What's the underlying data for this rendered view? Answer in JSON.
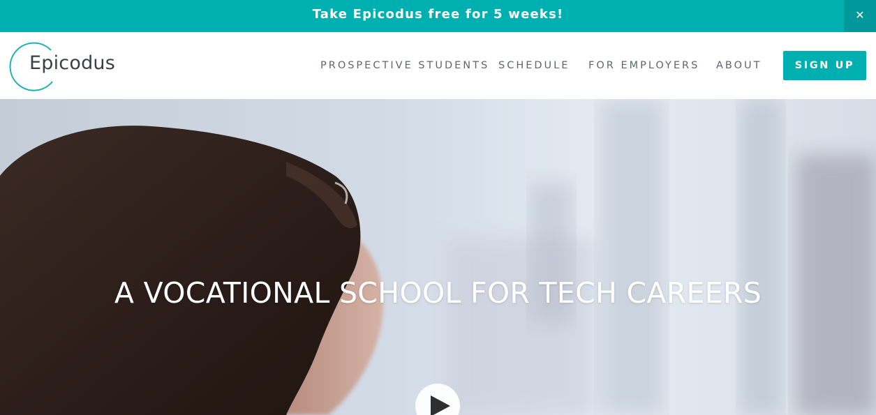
{
  "banner": {
    "text": "Take Epicodus free for 5 weeks!",
    "close_label": "✕"
  },
  "header": {
    "logo_text": "Epicodus",
    "nav": [
      {
        "label": "PROSPECTIVE STUDENTS"
      },
      {
        "label": "SCHEDULE"
      },
      {
        "label": "FOR EMPLOYERS"
      },
      {
        "label": "ABOUT"
      }
    ],
    "signup_label": "SIGN UP"
  },
  "hero": {
    "title": "A VOCATIONAL SCHOOL FOR TECH CAREERS",
    "play_icon": "play-icon"
  },
  "colors": {
    "brand_teal": "#00b0b0",
    "close_bg": "#00989a",
    "nav_text": "#5e666c",
    "logo_text": "#3a4048"
  }
}
